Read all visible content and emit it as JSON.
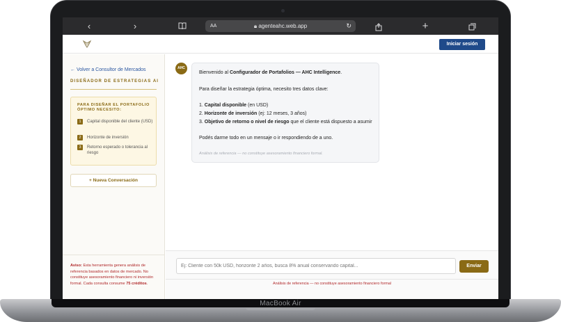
{
  "device": {
    "model_label": "MacBook Air"
  },
  "browser": {
    "icons": [
      "back-icon",
      "forward-icon",
      "bookmarks-icon",
      "share-icon",
      "new-tab-icon",
      "tabs-icon",
      "reload-icon"
    ],
    "text_size_label": "AA",
    "url": "agenteahc.web.app"
  },
  "header": {
    "login_label": "Iniciar sesión"
  },
  "sidebar": {
    "back_link": "← Volver a Consultor de Mercados",
    "title": "DISEÑADOR DE ESTRATEGIAS AI",
    "needs_title": "PARA DISEÑAR EL PORTAFOLIO ÓPTIMO NECESITO:",
    "steps": [
      {
        "num": "1",
        "label": "Capital disponible del cliente (USD)"
      },
      {
        "num": "2",
        "label": "Horizonte de inversión"
      },
      {
        "num": "3",
        "label": "Retorno esperado o tolerancia al riesgo"
      }
    ],
    "new_conversation": "+ Nueva Conversación",
    "warning_label": "Aviso:",
    "warning_text": "Esta herramienta genera análisis de referencia basados en datos de mercado. No constituye asesoramiento financiero ni inversión formal. Cada consulta consume",
    "warning_credits": "75 créditos",
    "warning_end": "."
  },
  "chat": {
    "avatar": "AHC",
    "greeting_pre": "Bienvenido al ",
    "greeting_bold": "Configurador de Portafolios — AHC Intelligence",
    "greeting_post": ".",
    "intro": "Para diseñar la estrategia óptima, necesito tres datos clave:",
    "items": [
      {
        "num": "1. ",
        "bold": "Capital disponible",
        "rest": " (en USD)"
      },
      {
        "num": "2. ",
        "bold": "Horizonte de inversión",
        "rest": " (ej: 12 meses, 3 años)"
      },
      {
        "num": "3. ",
        "bold": "Objetivo de retorno o nivel de riesgo",
        "rest": " que el cliente está dispuesto a asumir"
      }
    ],
    "closing": "Podés darme todo en un mensaje o ir respondiendo de a uno.",
    "note": "Análisis de referencia — no constituye asesoramiento financiero formal."
  },
  "composer": {
    "placeholder": "Ej: Cliente con 50k USD, horizonte 2 años, busca 8% anual conservando capital...",
    "send_label": "Enviar",
    "footer": "Análisis de referencia — no constituye asesoramiento financiero formal"
  },
  "colors": {
    "gold": "#8a6a15",
    "navy": "#1f4a8a",
    "warning": "#b0282a"
  }
}
